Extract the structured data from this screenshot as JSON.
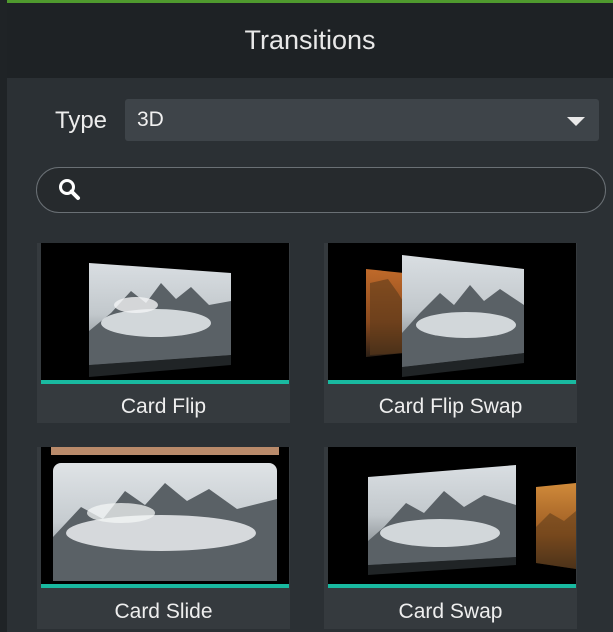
{
  "panel": {
    "title": "Transitions"
  },
  "filter": {
    "type_label": "Type",
    "type_value": "3D"
  },
  "search": {
    "placeholder": "",
    "value": ""
  },
  "transitions": [
    {
      "label": "Card Flip"
    },
    {
      "label": "Card Flip Swap"
    },
    {
      "label": "Card Slide"
    },
    {
      "label": "Card Swap"
    }
  ],
  "colors": {
    "accent_teal": "#19b9a0",
    "top_edge_green": "#4f9a2e",
    "panel_bg": "#2b3034",
    "header_bg": "#1e2225"
  },
  "icons": {
    "search": "magnifier-icon",
    "dropdown": "caret-down-icon"
  }
}
